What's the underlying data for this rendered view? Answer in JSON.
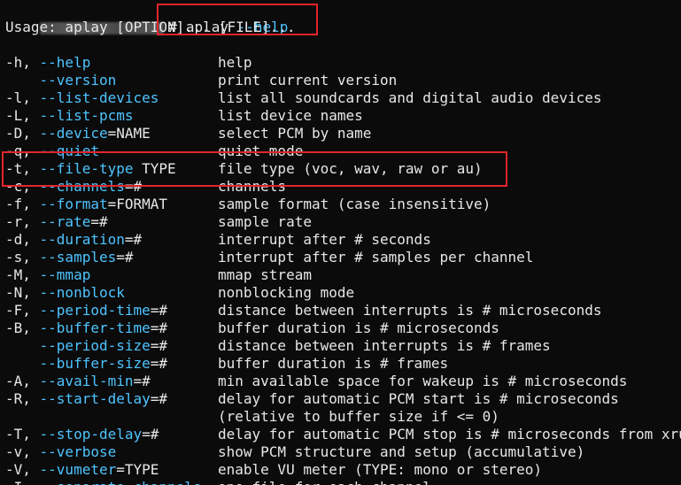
{
  "prompt": {
    "symbol": "#",
    "command": "aplay",
    "command_flag": "--help"
  },
  "usage": "Usage: aplay [OPTION]... [FILE]...",
  "options": [
    {
      "short": "-h, ",
      "flag": "--help",
      "arg": "",
      "desc": "help"
    },
    {
      "short": "    ",
      "flag": "--version",
      "arg": "",
      "desc": "print current version"
    },
    {
      "short": "-l, ",
      "flag": "--list-devices",
      "arg": "",
      "desc": "list all soundcards and digital audio devices"
    },
    {
      "short": "-L, ",
      "flag": "--list-pcms",
      "arg": "",
      "desc": "list device names"
    },
    {
      "short": "-D, ",
      "flag": "--device",
      "arg": "=NAME",
      "desc": "select PCM by name"
    },
    {
      "short": "-q, ",
      "flag": "--quiet",
      "arg": "",
      "desc": "quiet mode"
    },
    {
      "short": "-t, ",
      "flag": "--file-type",
      "arg": " TYPE",
      "desc": "file type (voc, wav, raw or au)"
    },
    {
      "short": "-c, ",
      "flag": "--channels",
      "arg": "=#",
      "desc": "channels"
    },
    {
      "short": "-f, ",
      "flag": "--format",
      "arg": "=FORMAT",
      "desc": "sample format (case insensitive)"
    },
    {
      "short": "-r, ",
      "flag": "--rate",
      "arg": "=#",
      "desc": "sample rate"
    },
    {
      "short": "-d, ",
      "flag": "--duration",
      "arg": "=#",
      "desc": "interrupt after # seconds"
    },
    {
      "short": "-s, ",
      "flag": "--samples",
      "arg": "=#",
      "desc": "interrupt after # samples per channel"
    },
    {
      "short": "-M, ",
      "flag": "--mmap",
      "arg": "",
      "desc": "mmap stream"
    },
    {
      "short": "-N, ",
      "flag": "--nonblock",
      "arg": "",
      "desc": "nonblocking mode"
    },
    {
      "short": "-F, ",
      "flag": "--period-time",
      "arg": "=#",
      "desc": "distance between interrupts is # microseconds"
    },
    {
      "short": "-B, ",
      "flag": "--buffer-time",
      "arg": "=#",
      "desc": "buffer duration is # microseconds"
    },
    {
      "short": "    ",
      "flag": "--period-size",
      "arg": "=#",
      "desc": "distance between interrupts is # frames"
    },
    {
      "short": "    ",
      "flag": "--buffer-size",
      "arg": "=#",
      "desc": "buffer duration is # frames"
    },
    {
      "short": "-A, ",
      "flag": "--avail-min",
      "arg": "=#",
      "desc": "min available space for wakeup is # microseconds"
    },
    {
      "short": "-R, ",
      "flag": "--start-delay",
      "arg": "=#",
      "desc": "delay for automatic PCM start is # microseconds"
    },
    {
      "short": "",
      "flag": "",
      "arg": "",
      "desc": "(relative to buffer size if <= 0)"
    },
    {
      "short": "-T, ",
      "flag": "--stop-delay",
      "arg": "=#",
      "desc": "delay for automatic PCM stop is # microseconds from xrun"
    },
    {
      "short": "-v, ",
      "flag": "--verbose",
      "arg": "",
      "desc": "show PCM structure and setup (accumulative)"
    },
    {
      "short": "-V, ",
      "flag": "--vumeter",
      "arg": "=TYPE",
      "desc": "enable VU meter (TYPE: mono or stereo)"
    },
    {
      "short": "-I, ",
      "flag": "--separate-channels",
      "arg": "",
      "desc": "one file for each channel"
    }
  ],
  "highlight_color": "#e2252b",
  "flag_color": "#4ec4ff"
}
